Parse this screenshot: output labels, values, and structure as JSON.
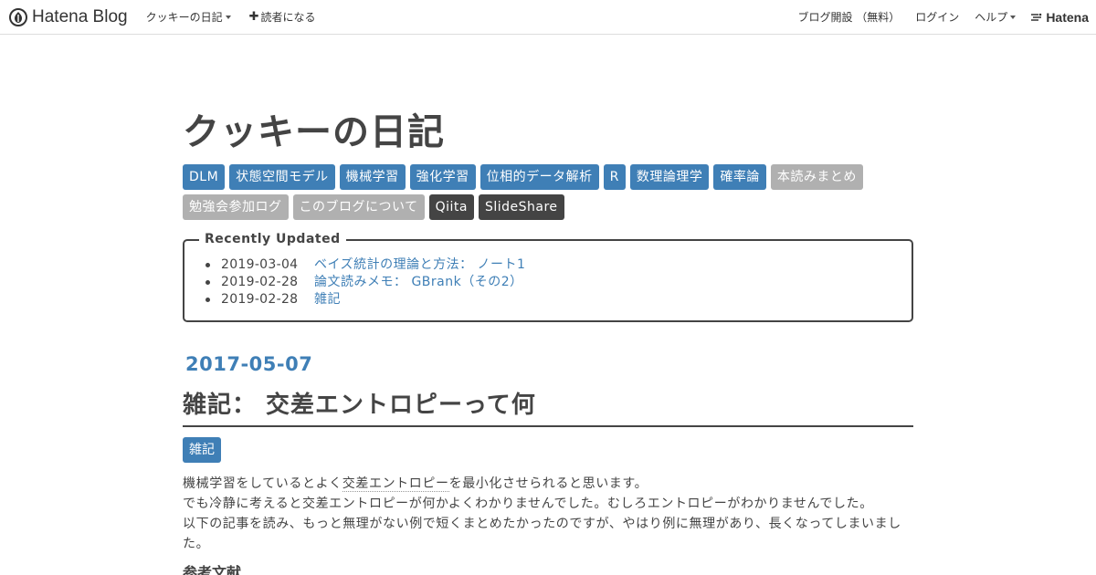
{
  "header": {
    "logo_text": "Hatena Blog",
    "blog_menu_label": "クッキーの日記",
    "subscribe_label": "読者になる",
    "open_blog_label": "ブログ開設 （無料）",
    "login_label": "ログイン",
    "help_label": "ヘルプ",
    "hatena_label": "Hatena"
  },
  "blog": {
    "title": "クッキーの日記",
    "categories": [
      {
        "label": "DLM",
        "style": "blue"
      },
      {
        "label": "状態空間モデル",
        "style": "blue"
      },
      {
        "label": "機械学習",
        "style": "blue"
      },
      {
        "label": "強化学習",
        "style": "blue"
      },
      {
        "label": "位相的データ解析",
        "style": "blue"
      },
      {
        "label": "R",
        "style": "blue"
      },
      {
        "label": "数理論理学",
        "style": "blue"
      },
      {
        "label": "確率論",
        "style": "blue"
      },
      {
        "label": "本読みまとめ",
        "style": "gray"
      },
      {
        "label": "勉強会参加ログ",
        "style": "gray"
      },
      {
        "label": "このブログについて",
        "style": "gray"
      },
      {
        "label": "Qiita",
        "style": "dark"
      },
      {
        "label": "SlideShare",
        "style": "dark"
      }
    ],
    "recent": {
      "legend": "Recently Updated",
      "items": [
        {
          "date": "2019-03-04",
          "title": "ベイズ統計の理論と方法： ノート1"
        },
        {
          "date": "2019-02-28",
          "title": "論文読みメモ： GBrank（その2）"
        },
        {
          "date": "2019-02-28",
          "title": "雑記"
        }
      ]
    }
  },
  "entry": {
    "date": "2017-05-07",
    "title": "雑記： 交差エントロピーって何",
    "category": "雑記",
    "para1_pre": "機械学習をしているとよく",
    "para1_kw": "交差エントロピー",
    "para1_post": "を最小化させられると思います。",
    "para2": "でも冷静に考えると交差エントロピーが何かよくわかりませんでした。むしろエントロピーがわかりませんでした。",
    "para3": "以下の記事を読み、もっと無理がない例で短くまとめたかったのですが、やはり例に無理があり、長くなってしまいました。",
    "heading": "参考文献"
  },
  "colors": {
    "accent": "#3f7fb6",
    "text": "#444444",
    "tag_gray": "#b0b0b0",
    "tag_dark": "#444444"
  }
}
